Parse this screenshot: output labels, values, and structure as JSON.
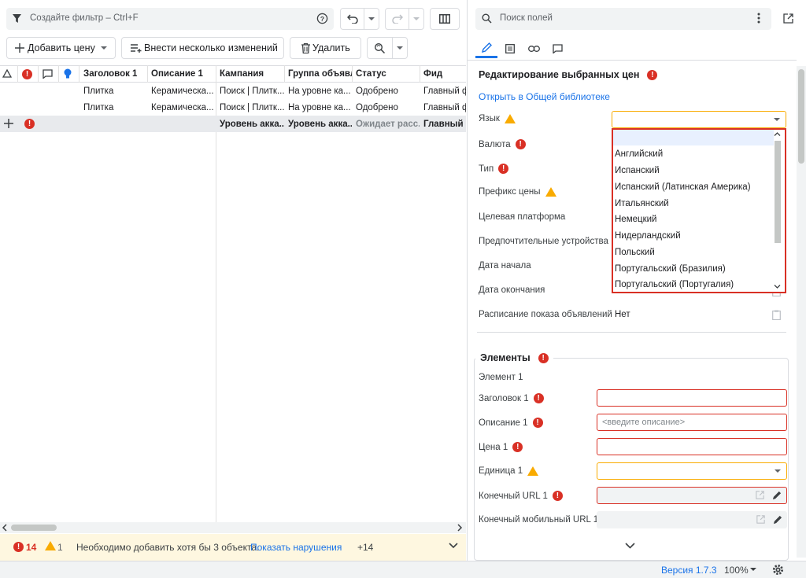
{
  "toolbar": {
    "filter_placeholder": "Создайте фильтр – Ctrl+F",
    "add_price_label": "Добавить цену",
    "bulk_edit_label": "Внести несколько изменений",
    "delete_label": "Удалить"
  },
  "grid": {
    "columns": [
      "Заголовок 1",
      "Описание 1",
      "Кампания",
      "Группа объявл...",
      "Статус",
      "Фид"
    ],
    "rows": [
      [
        "Плитка",
        "Керамическа...",
        "Поиск | Плитк...",
        "На уровне ка...",
        "Одобрено",
        "Главный ф"
      ],
      [
        "Плитка",
        "Керамическа...",
        "Поиск | Плитк...",
        "На уровне ка...",
        "Одобрено",
        "Главный ф"
      ]
    ],
    "summary": [
      "Уровень акка...",
      "Уровень акка...",
      "Ожидает расс...",
      "Главный ф"
    ]
  },
  "status": {
    "errors": "14",
    "warnings": "1",
    "message": "Необходимо добавить хотя бы 3 объекта.",
    "link": "Показать нарушения",
    "more": "+14"
  },
  "right": {
    "search_placeholder": "Поиск полей",
    "section_title": "Редактирование выбранных цен",
    "open_library": "Открыть в Общей библиотеке",
    "fields": {
      "language": "Язык",
      "currency": "Валюта",
      "type": "Тип",
      "price_prefix": "Префикс цены",
      "target_platform": "Целевая платформа",
      "preferred_devices": "Предпочтительные устройства",
      "start_date": "Дата начала",
      "end_date": "Дата окончания",
      "ad_schedule": "Расписание показа объявлений",
      "ad_schedule_value": "Нет"
    },
    "language_options": [
      "Английский",
      "Испанский",
      "Испанский (Латинская Америка)",
      "Итальянский",
      "Немецкий",
      "Нидерландский",
      "Польский",
      "Португальский (Бразилия)",
      "Португальский (Португалия)"
    ],
    "elements": {
      "title": "Элементы",
      "item": "Элемент 1",
      "header1": "Заголовок 1",
      "desc1": "Описание 1",
      "desc_placeholder": "<введите описание>",
      "price1": "Цена 1",
      "unit1": "Единица 1",
      "final_url": "Конечный URL 1",
      "final_mobile_url": "Конечный мобильный URL 1"
    }
  },
  "bottom": {
    "version": "Версия 1.7.3",
    "zoom": "100%"
  },
  "colors": {
    "accent": "#1a73e8",
    "error": "#d93025",
    "warning": "#f9ab00"
  }
}
